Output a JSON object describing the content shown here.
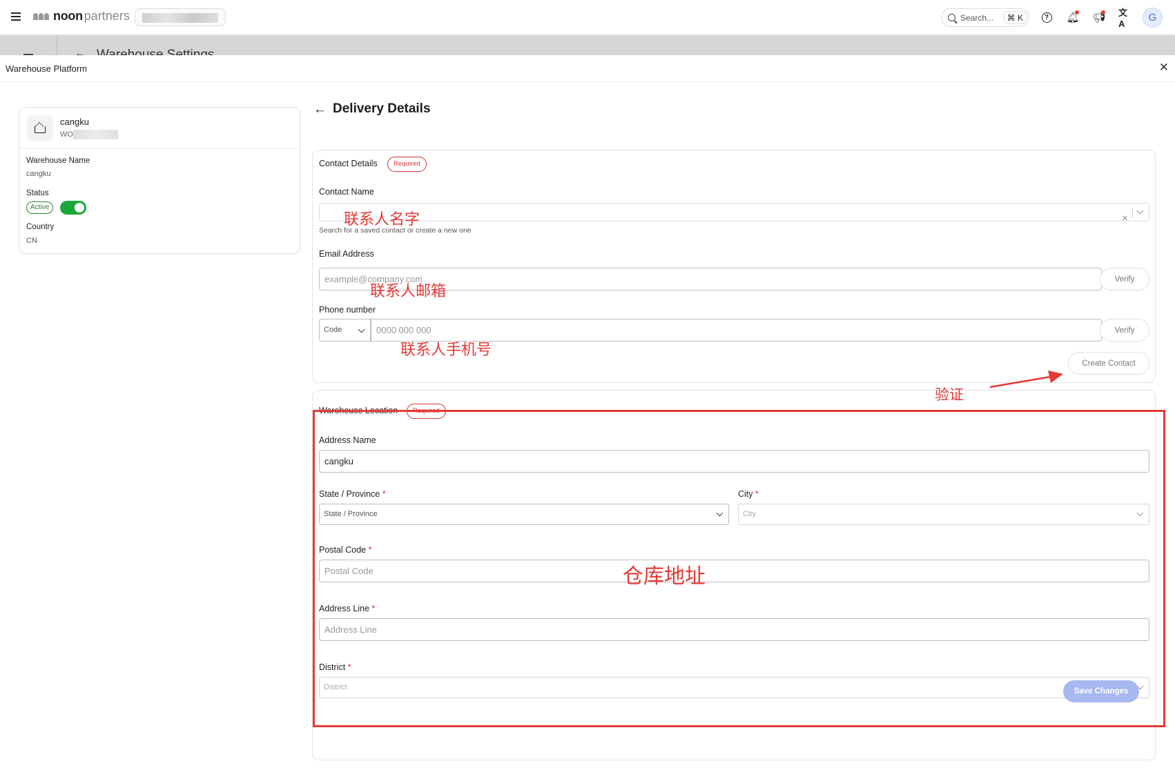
{
  "topbar": {
    "logo_noon": "noon",
    "logo_partners": "partners",
    "search_placeholder": "Search...",
    "search_shortcut": "⌘ K",
    "avatar_initial": "G"
  },
  "backdrop": {
    "page_title": "Warehouse Settings"
  },
  "modal": {
    "title": "Warehouse Platform",
    "close_glyph": "✕"
  },
  "warehouse": {
    "name": "cangku",
    "id_prefix": "WO",
    "name_label": "Warehouse Name",
    "name_value": "cangku",
    "status_label": "Status",
    "status_value": "Active",
    "status_on": true,
    "country_label": "Country",
    "country_value": "CN"
  },
  "page": {
    "title": "Delivery Details"
  },
  "contact": {
    "section_title": "Contact Details",
    "required_badge": "Required",
    "name_label": "Contact Name",
    "name_value": "",
    "name_helper": "Search for a saved contact or create a new one",
    "email_label": "Email Address",
    "email_placeholder": "example@company.com",
    "email_verify": "Verify",
    "phone_label": "Phone number",
    "phone_code_placeholder": "Code",
    "phone_placeholder": "0000 000 000",
    "phone_verify": "Verify",
    "create_button": "Create Contact"
  },
  "location": {
    "section_title": "Warehouse Location",
    "required_badge": "Required",
    "address_name_label": "Address Name",
    "address_name_value": "cangku",
    "state_label": "State / Province",
    "state_placeholder": "State / Province",
    "city_label": "City",
    "city_placeholder": "City",
    "postal_label": "Postal Code",
    "postal_placeholder": "Postal Code",
    "address_line_label": "Address Line",
    "address_line_placeholder": "Address Line",
    "district_label": "District",
    "district_placeholder": "District",
    "required_marker": "*"
  },
  "actions": {
    "save_button": "Save Changes"
  },
  "annotations": {
    "contact_name": "联系人名字",
    "contact_email": "联系人邮箱",
    "contact_phone": "联系人手机号",
    "verify": "验证",
    "warehouse_address": "仓库地址"
  },
  "colors": {
    "accent_red": "#e53935",
    "toggle_green": "#1aa839",
    "save_button_disabled": "#a8b8f0"
  }
}
